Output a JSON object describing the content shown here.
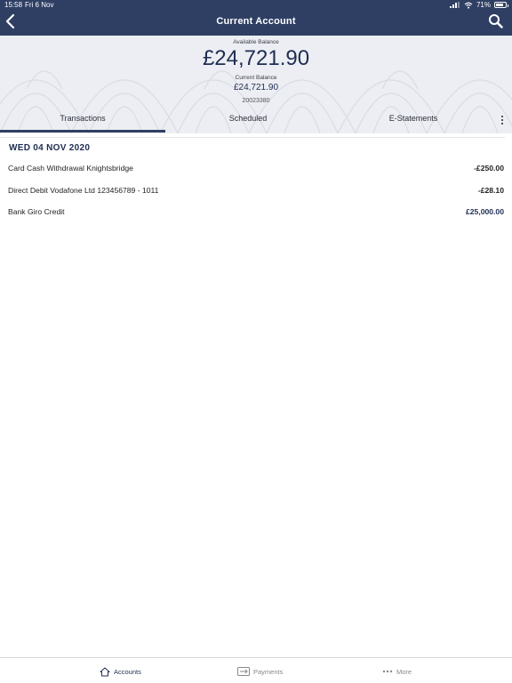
{
  "status_bar": {
    "time": "15:58",
    "date": "Fri 6 Nov",
    "battery": "71%"
  },
  "header": {
    "title": "Current Account"
  },
  "balance": {
    "available_label": "Available Balance",
    "available_amount": "£24,721.90",
    "current_label": "Current Balance",
    "current_amount": "£24,721.90",
    "account_number": "20023380"
  },
  "tabs": [
    {
      "label": "Transactions",
      "active": true
    },
    {
      "label": "Scheduled",
      "active": false
    },
    {
      "label": "E-Statements",
      "active": false
    }
  ],
  "transactions": {
    "date_header": "WED 04 NOV 2020",
    "items": [
      {
        "description": "Card Cash Withdrawal Knightsbridge",
        "amount": "-£250.00"
      },
      {
        "description": "Direct Debit Vodafone Ltd 123456789 - 1011",
        "amount": "-£28.10"
      },
      {
        "description": "Bank Giro Credit",
        "amount": "£25,000.00"
      }
    ]
  },
  "bottom_nav": [
    {
      "label": "Accounts",
      "icon": "home-icon",
      "active": true
    },
    {
      "label": "Payments",
      "icon": "payments-icon",
      "active": false
    },
    {
      "label": "More",
      "icon": "more-icon",
      "active": false
    }
  ],
  "colors": {
    "header_bg": "#2f3f64",
    "accent": "#1f2d52",
    "debit": "#222222",
    "credit": "#1f2d52"
  }
}
